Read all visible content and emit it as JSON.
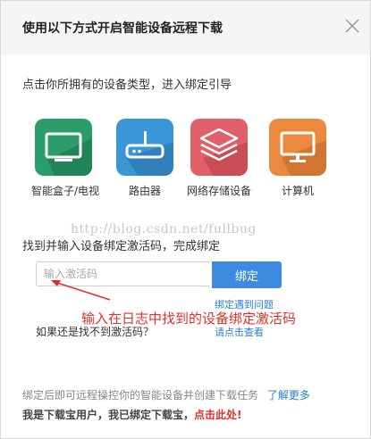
{
  "dialog": {
    "title": "使用以下方式开启智能设备远程下载",
    "close_icon": "close-icon"
  },
  "devices_section": {
    "prompt": "点击你所拥有的设备类型，进入绑定引导",
    "items": [
      {
        "label": "智能盒子/电视",
        "icon": "tv-icon",
        "color": "#2a9d6a"
      },
      {
        "label": "路由器",
        "icon": "router-icon",
        "color": "#3a96d6"
      },
      {
        "label": "网络存储设备",
        "icon": "storage-stack-icon",
        "color": "#e0606a"
      },
      {
        "label": "计算机",
        "icon": "monitor-icon",
        "color": "#eb8a3e"
      }
    ]
  },
  "watermark": "http://blog.csdn.net/fullbug",
  "bind_section": {
    "prompt": "找到并输入设备绑定激活码，完成绑定",
    "input_placeholder": "输入激活码",
    "bind_button": "绑定",
    "help_link": "绑定遇到问题",
    "not_found_text": "如果还是找不到激活码？",
    "click_here_link": "请点击查看"
  },
  "annotation": "输入在日志中找到的设备绑定激活码",
  "footer": {
    "info_text": "绑定后即可远程操控你的智能设备并创建下载任务",
    "learn_more_link": "了解更多",
    "user_text": "我是下载宝用户，我已绑定下载宝，",
    "user_link": "点击此处!"
  }
}
